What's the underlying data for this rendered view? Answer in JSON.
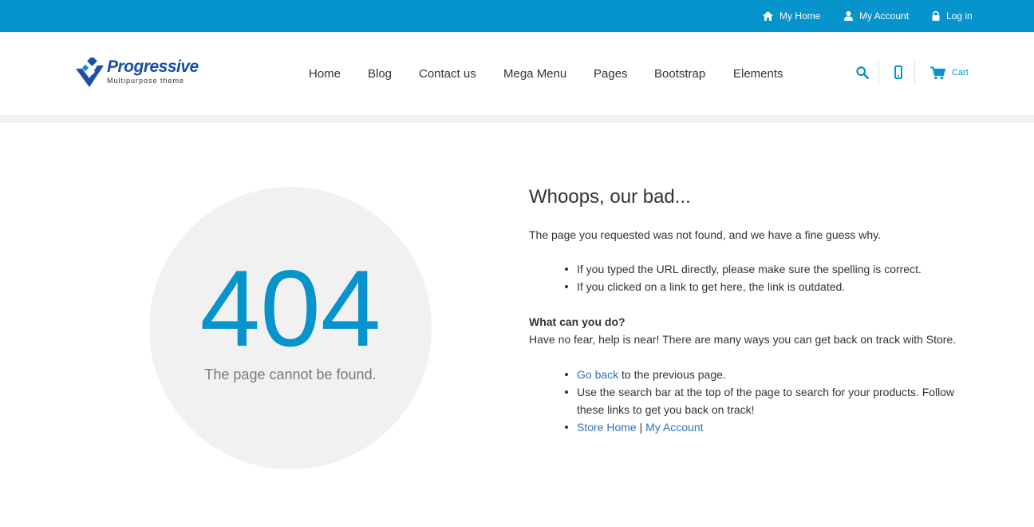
{
  "colors": {
    "accent": "#0793cc",
    "logo_blue": "#1a4fa3",
    "link": "#2f71b5",
    "circle_bg": "#f1f1f1"
  },
  "topbar": {
    "my_home": "My Home",
    "my_account": "My Account",
    "log_in": "Log in"
  },
  "logo": {
    "title": "Progressive",
    "subtitle": "Multipurpose theme"
  },
  "nav": {
    "items": [
      {
        "label": "Home"
      },
      {
        "label": "Blog"
      },
      {
        "label": "Contact us"
      },
      {
        "label": "Mega Menu"
      },
      {
        "label": "Pages"
      },
      {
        "label": "Bootstrap"
      },
      {
        "label": "Elements"
      }
    ]
  },
  "header_icons": {
    "search": "search-icon",
    "phone": "mobile-icon",
    "cart": "cart-icon"
  },
  "cart": {
    "label": "Cart"
  },
  "error": {
    "code": "404",
    "subtitle": "The page cannot be found."
  },
  "content": {
    "heading": "Whoops, our bad...",
    "intro": "The page you requested was not found, and we have a fine guess why.",
    "reasons": [
      "If you typed the URL directly, please make sure the spelling is correct.",
      "If you clicked on a link to get here, the link is outdated."
    ],
    "what_heading": "What can you do?",
    "what_text": "Have no fear, help is near! There are many ways you can get back on track with Store.",
    "actions": {
      "go_back_link": "Go back",
      "go_back_rest": " to the previous page.",
      "search_line1": "Use the search bar at the top of the page to search for your products. Follow",
      "search_line2": "these links to get you back on track!",
      "store_home": "Store Home",
      "separator": " | ",
      "my_account": "My Account"
    }
  }
}
